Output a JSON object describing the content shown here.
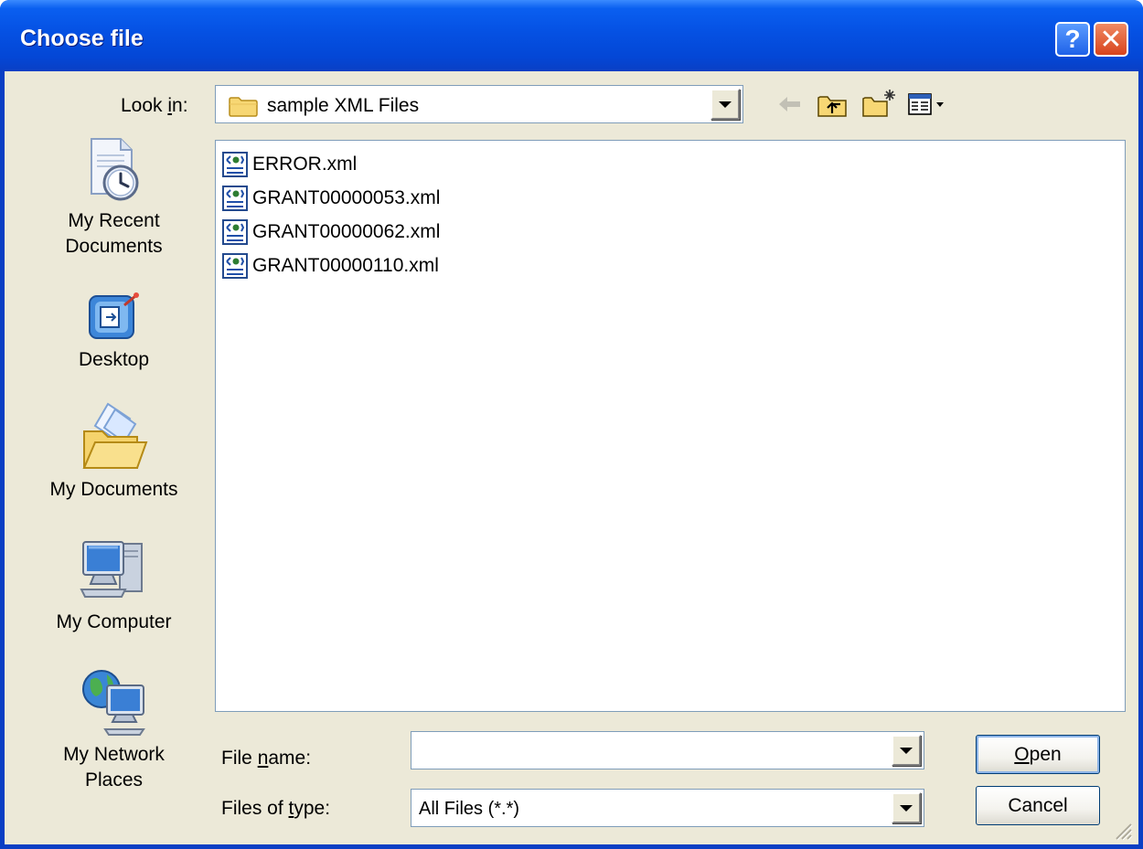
{
  "window": {
    "title": "Choose file",
    "help_symbol": "?",
    "close_symbol": "✕"
  },
  "toolbar": {
    "look_in_label_pre": "Look ",
    "look_in_label_ul": "i",
    "look_in_label_post": "n:",
    "look_in_value": "sample XML Files",
    "icons": [
      "back-icon",
      "up-folder-icon",
      "new-folder-icon",
      "view-menu-icon"
    ]
  },
  "places": [
    {
      "label_line1": "My Recent",
      "label_line2": "Documents",
      "icon": "recent-documents-icon"
    },
    {
      "label_line1": "Desktop",
      "label_line2": "",
      "icon": "desktop-icon"
    },
    {
      "label_line1": "My Documents",
      "label_line2": "",
      "icon": "my-documents-icon"
    },
    {
      "label_line1": "My Computer",
      "label_line2": "",
      "icon": "my-computer-icon"
    },
    {
      "label_line1": "My Network",
      "label_line2": "Places",
      "icon": "network-places-icon"
    }
  ],
  "files": [
    {
      "name": "ERROR.xml"
    },
    {
      "name": "GRANT00000053.xml"
    },
    {
      "name": "GRANT00000062.xml"
    },
    {
      "name": "GRANT00000110.xml"
    }
  ],
  "form": {
    "file_name_label_pre": "File ",
    "file_name_label_ul": "n",
    "file_name_label_post": "ame:",
    "file_name_value": "",
    "file_type_label_pre": "Files of ",
    "file_type_label_ul": "t",
    "file_type_label_post": "ype:",
    "file_type_value": "All Files (*.*)"
  },
  "buttons": {
    "open_ul": "O",
    "open_rest": "pen",
    "cancel": "Cancel"
  }
}
